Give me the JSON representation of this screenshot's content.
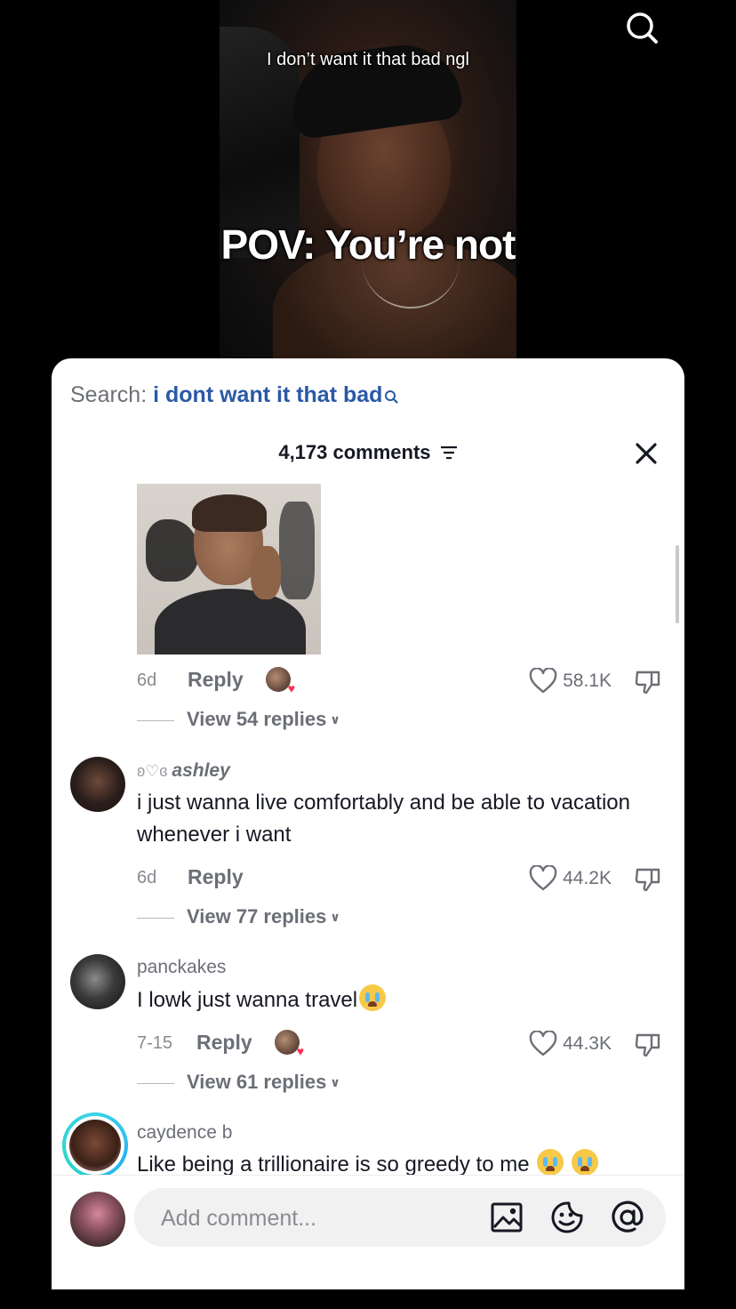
{
  "video": {
    "caption_small": "I don’t want it that bad ngl",
    "caption_big": "POV: You’re not",
    "search_icon": "search-icon"
  },
  "panel": {
    "search_label": "Search:",
    "search_query": "i dont want it that bad",
    "comment_count": "4,173 comments",
    "filter_icon": "filter-icon",
    "close_icon": "close-icon"
  },
  "comments": [
    {
      "has_image": true,
      "date": "6d",
      "reply": "Reply",
      "likes": "58.1K",
      "view_replies": "View 54 replies"
    },
    {
      "username": "ashley",
      "text": "i just wanna live comfortably and be able to vacation whenever i want",
      "date": "6d",
      "reply": "Reply",
      "likes": "44.2K",
      "view_replies": "View 77 replies"
    },
    {
      "username": "panckakes",
      "text": "I lowk just wanna travel",
      "date": "7-15",
      "reply": "Reply",
      "likes": "44.3K",
      "view_replies": "View 61 replies"
    },
    {
      "username": "caydence b",
      "text": "Like being a trillionaire is so greedy to me"
    }
  ],
  "composer": {
    "placeholder": "Add comment...",
    "icons": [
      "image-icon",
      "emoji-sticker-icon",
      "mention-icon"
    ]
  },
  "colors": {
    "link_blue": "#2b59a6",
    "like_pink": "#fe2c55",
    "text_primary": "#161823",
    "text_secondary": "#6c6f77"
  }
}
